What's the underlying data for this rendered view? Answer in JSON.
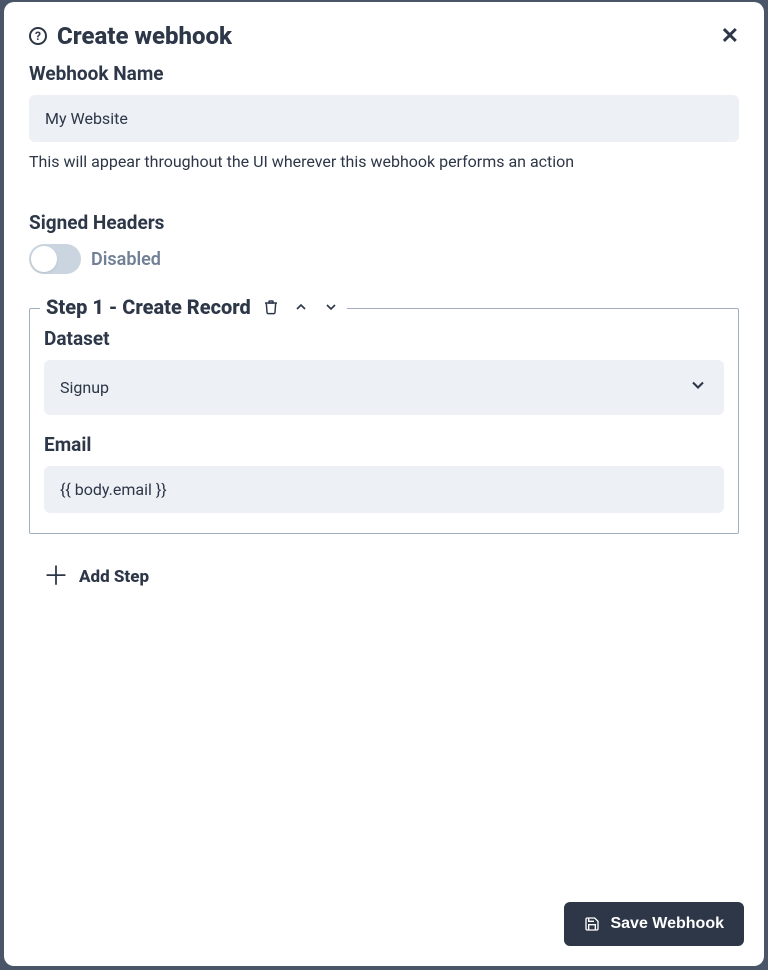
{
  "header": {
    "title": "Create webhook"
  },
  "webhook_name": {
    "label": "Webhook Name",
    "value": "My Website",
    "helper": "This will appear throughout the UI wherever this webhook performs an action"
  },
  "signed_headers": {
    "label": "Signed Headers",
    "status": "Disabled"
  },
  "step1": {
    "title": "Step 1 - Create Record",
    "dataset": {
      "label": "Dataset",
      "selected": "Signup"
    },
    "email": {
      "label": "Email",
      "value": "{{ body.email }}"
    }
  },
  "add_step": {
    "label": "Add Step"
  },
  "save": {
    "label": "Save Webhook"
  }
}
